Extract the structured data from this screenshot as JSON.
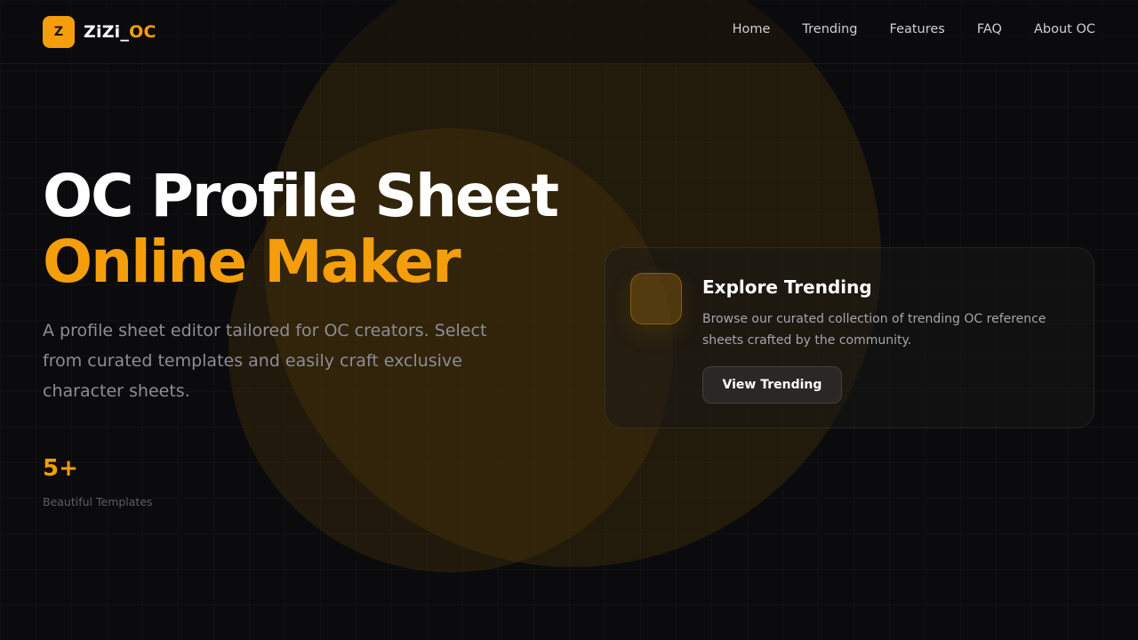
{
  "brand": {
    "logo_letter": "Z",
    "name_main": "ZiZi_",
    "name_accent": "OC"
  },
  "nav": {
    "items": [
      {
        "label": "Home"
      },
      {
        "label": "Trending"
      },
      {
        "label": "Features"
      },
      {
        "label": "FAQ"
      },
      {
        "label": "About OC"
      }
    ]
  },
  "hero": {
    "title_line1": "OC Profile Sheet",
    "title_line2": "Online Maker",
    "description": "A profile sheet editor tailored for OC creators. Select from curated templates and easily craft exclusive character sheets.",
    "stat_value": "5+",
    "stat_label": "Beautiful Templates"
  },
  "card": {
    "title": "Explore Trending",
    "description": "Browse our curated collection of trending OC reference sheets crafted by the community.",
    "button_label": "View Trending"
  },
  "colors": {
    "accent": "#f59e0b",
    "background": "#0b0b0d"
  }
}
